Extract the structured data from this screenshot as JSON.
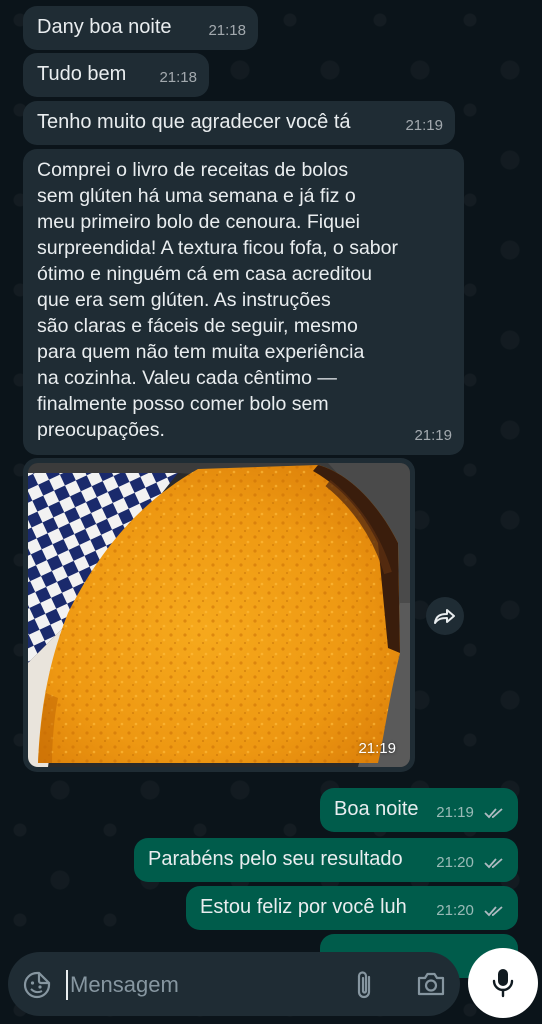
{
  "conversation": {
    "messages": [
      {
        "direction": "in",
        "text": "Dany boa noite",
        "time": "21:18"
      },
      {
        "direction": "in",
        "text": "Tudo bem",
        "time": "21:18"
      },
      {
        "direction": "in",
        "text": "Tenho muito que agradecer você tá",
        "time": "21:19"
      },
      {
        "direction": "in",
        "text": "Comprei o livro de receitas de bolos\nsem glúten há uma semana e já fiz o\nmeu primeiro bolo de cenoura. Fiquei\nsurpreendida! A textura ficou fofa, o sabor\nótimo e ninguém cá em casa acreditou\nque era sem glúten. As instruções\nsão claras e fáceis de seguir, mesmo\npara quem não tem muita experiência\nna cozinha. Valeu cada cêntimo —\nfinalmente posso comer bolo sem\npreocupações.",
        "time": "21:19"
      },
      {
        "direction": "in",
        "type": "photo",
        "time": "21:19"
      },
      {
        "direction": "out",
        "text": "Boa noite",
        "time": "21:19",
        "status_icon": "double-check-icon"
      },
      {
        "direction": "out",
        "text": "Parabéns pelo seu resultado",
        "time": "21:20",
        "status_icon": "double-check-icon"
      },
      {
        "direction": "out",
        "text": "Estou feliz por você luh",
        "time": "21:20",
        "status_icon": "double-check-icon"
      }
    ]
  },
  "composer": {
    "placeholder": "Mensagem",
    "icons": [
      "sticker-icon",
      "attach-icon",
      "camera-icon",
      "mic-icon"
    ]
  },
  "colors": {
    "background": "#0b141a",
    "incoming_bubble": "#1f2c34",
    "outgoing_bubble": "#005c4b",
    "text": "#e9edef"
  }
}
